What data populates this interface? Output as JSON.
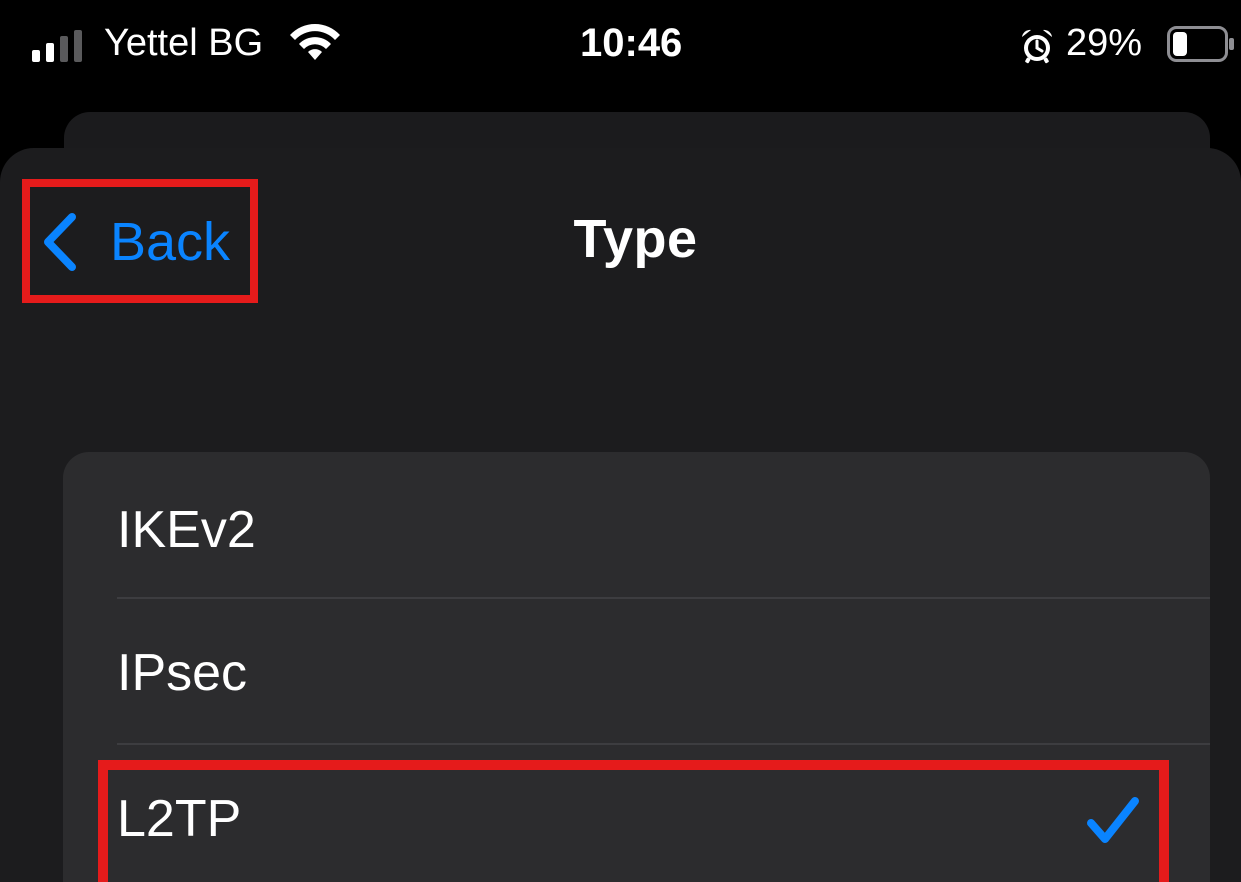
{
  "status_bar": {
    "carrier": "Yettel BG",
    "time": "10:46",
    "battery_percent": "29%",
    "signal_icon": "signal-bars-icon",
    "wifi_icon": "wifi-icon",
    "alarm_icon": "alarm-clock-icon",
    "battery_icon": "battery-icon",
    "battery_level": 0.29
  },
  "nav": {
    "back_label": "Back",
    "back_icon": "chevron-left-icon",
    "title": "Type"
  },
  "options": [
    {
      "label": "IKEv2",
      "selected": false
    },
    {
      "label": "IPsec",
      "selected": false
    },
    {
      "label": "L2TP",
      "selected": true
    }
  ],
  "colors": {
    "accent": "#0a84ff",
    "highlight": "#e51b1b",
    "sheet": "#1c1c1e",
    "list": "#2c2c2e"
  }
}
